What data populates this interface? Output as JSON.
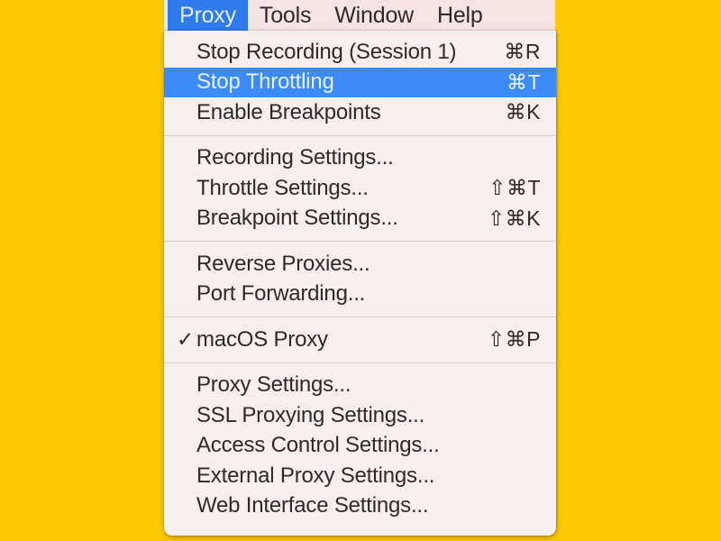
{
  "colors": {
    "desktop_background": "#FCC800",
    "menubar_background": "#F6E3E3",
    "menu_background": "#F5EFEE",
    "highlight_blue": "#3D8BFB",
    "menubar_active_blue": "#2F7BED",
    "text": "#2E2A28",
    "highlight_text": "#E9F3FE",
    "separator": "#D8D1D0"
  },
  "menubar": {
    "items": [
      {
        "label": "Proxy",
        "active": true
      },
      {
        "label": "Tools",
        "active": false
      },
      {
        "label": "Window",
        "active": false
      },
      {
        "label": "Help",
        "active": false
      }
    ]
  },
  "menu": {
    "title": "Proxy",
    "groups": [
      {
        "items": [
          {
            "label": "Stop Recording (Session 1)",
            "shortcut": "⌘R",
            "checked": false,
            "highlighted": false
          },
          {
            "label": "Stop Throttling",
            "shortcut": "⌘T",
            "checked": false,
            "highlighted": true
          },
          {
            "label": "Enable Breakpoints",
            "shortcut": "⌘K",
            "checked": false,
            "highlighted": false
          }
        ]
      },
      {
        "items": [
          {
            "label": "Recording Settings...",
            "shortcut": "",
            "checked": false,
            "highlighted": false
          },
          {
            "label": "Throttle Settings...",
            "shortcut": "⇧⌘T",
            "checked": false,
            "highlighted": false
          },
          {
            "label": "Breakpoint Settings...",
            "shortcut": "⇧⌘K",
            "checked": false,
            "highlighted": false
          }
        ]
      },
      {
        "items": [
          {
            "label": "Reverse Proxies...",
            "shortcut": "",
            "checked": false,
            "highlighted": false
          },
          {
            "label": "Port Forwarding...",
            "shortcut": "",
            "checked": false,
            "highlighted": false
          }
        ]
      },
      {
        "items": [
          {
            "label": "macOS Proxy",
            "shortcut": "⇧⌘P",
            "checked": true,
            "highlighted": false
          }
        ]
      },
      {
        "items": [
          {
            "label": "Proxy Settings...",
            "shortcut": "",
            "checked": false,
            "highlighted": false
          },
          {
            "label": "SSL Proxying Settings...",
            "shortcut": "",
            "checked": false,
            "highlighted": false
          },
          {
            "label": "Access Control Settings...",
            "shortcut": "",
            "checked": false,
            "highlighted": false
          },
          {
            "label": "External Proxy Settings...",
            "shortcut": "",
            "checked": false,
            "highlighted": false
          },
          {
            "label": "Web Interface Settings...",
            "shortcut": "",
            "checked": false,
            "highlighted": false
          }
        ]
      }
    ],
    "checkmark_glyph": "✓"
  }
}
